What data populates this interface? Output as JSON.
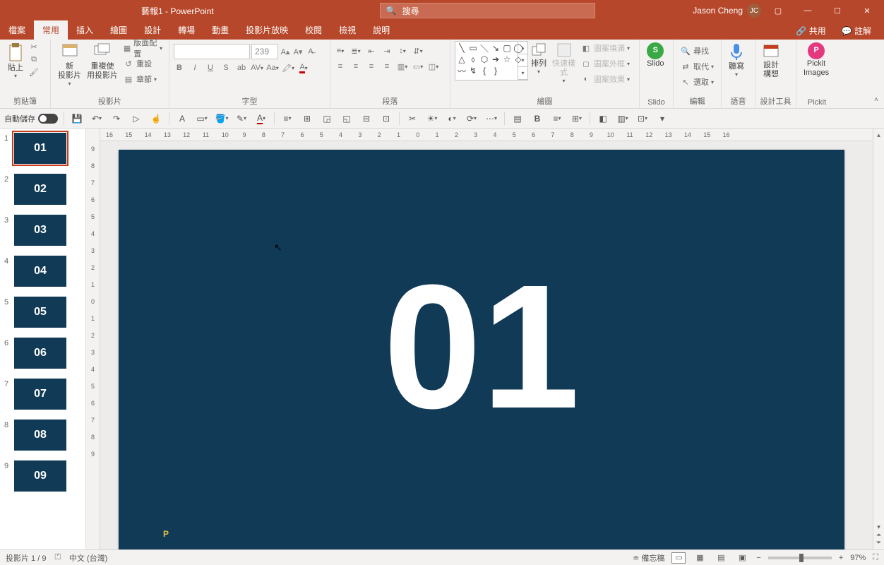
{
  "title": "藝報1  -  PowerPoint",
  "search": {
    "placeholder": "搜尋"
  },
  "user": {
    "name": "Jason Cheng",
    "initials": "JC"
  },
  "window_buttons": {
    "present": "▢",
    "min": "—",
    "max": "☐",
    "close": "✕"
  },
  "tabs": [
    "檔案",
    "常用",
    "插入",
    "繪圖",
    "設計",
    "轉場",
    "動畫",
    "投影片放映",
    "校閱",
    "檢視",
    "說明"
  ],
  "active_tab": "常用",
  "ribbon_right": {
    "share": "共用",
    "comments": "註解"
  },
  "groups": {
    "clipboard": {
      "label": "剪貼簿",
      "paste": "貼上"
    },
    "slides": {
      "label": "投影片",
      "new": "新\n投影片",
      "reuse": "重複使\n用投影片",
      "layout": "版面配置",
      "reset": "重設",
      "section": "章節"
    },
    "font": {
      "label": "字型",
      "size": "239"
    },
    "paragraph": {
      "label": "段落"
    },
    "drawing": {
      "label": "繪圖",
      "arrange": "排列",
      "quick": "快速樣\n式",
      "fill": "圖案填滿",
      "outline": "圖案外框",
      "effects": "圖案效果"
    },
    "slido": {
      "label": "Slido",
      "btn": "Slido"
    },
    "editing": {
      "label": "編輯",
      "find": "尋找",
      "replace": "取代",
      "select": "選取"
    },
    "voice": {
      "label": "語音",
      "btn": "聽寫"
    },
    "designer": {
      "label": "設計工具",
      "btn": "設計\n構想"
    },
    "pickit": {
      "label": "Pickit",
      "btn": "Pickit\nImages"
    }
  },
  "autosave": "自動儲存",
  "hruler": [
    "16",
    "15",
    "14",
    "13",
    "12",
    "11",
    "10",
    "9",
    "8",
    "7",
    "6",
    "5",
    "4",
    "3",
    "2",
    "1",
    "0",
    "1",
    "2",
    "3",
    "4",
    "5",
    "6",
    "7",
    "8",
    "9",
    "10",
    "11",
    "12",
    "13",
    "14",
    "15",
    "16"
  ],
  "vruler": [
    "9",
    "8",
    "7",
    "6",
    "5",
    "4",
    "3",
    "2",
    "1",
    "0",
    "1",
    "2",
    "3",
    "4",
    "5",
    "6",
    "7",
    "8",
    "9"
  ],
  "thumbnails": [
    {
      "n": "1",
      "label": "01",
      "selected": true
    },
    {
      "n": "2",
      "label": "02"
    },
    {
      "n": "3",
      "label": "03"
    },
    {
      "n": "4",
      "label": "04"
    },
    {
      "n": "5",
      "label": "05"
    },
    {
      "n": "6",
      "label": "06"
    },
    {
      "n": "7",
      "label": "07"
    },
    {
      "n": "8",
      "label": "08"
    },
    {
      "n": "9",
      "label": "09"
    }
  ],
  "current_slide_text": "01",
  "status": {
    "slide": "投影片 1 / 9",
    "lang": "中文 (台灣)",
    "notes": "備忘稿",
    "zoom": "97%"
  }
}
